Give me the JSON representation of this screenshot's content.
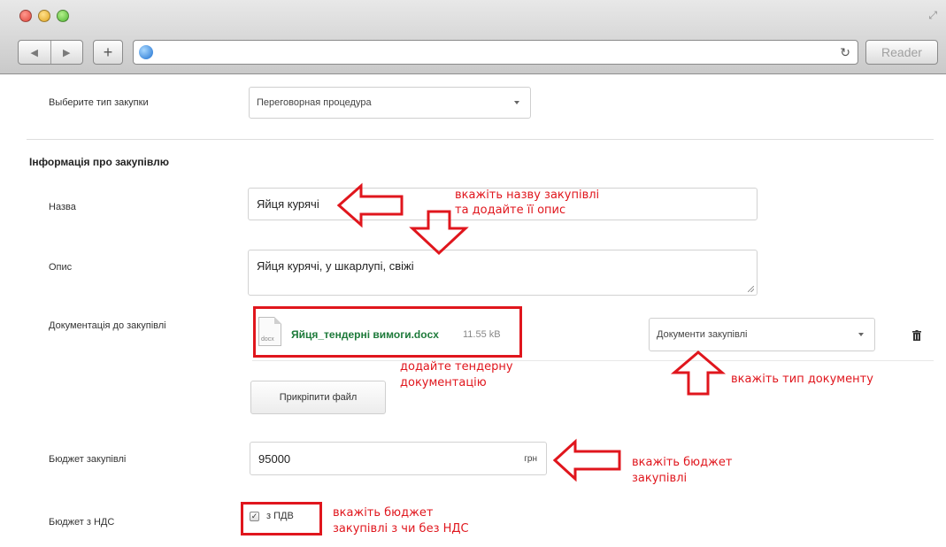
{
  "browser": {
    "reader_label": "Reader",
    "colors": {
      "close": "#e0443a",
      "minimize": "#e0a420",
      "zoom": "#4fb532"
    }
  },
  "form": {
    "purchase_type": {
      "label": "Выберите тип закупки",
      "value": "Переговорная процедура"
    },
    "section_title": "Інформація про закупівлю",
    "name": {
      "label": "Назва",
      "value": "Яйця курячі"
    },
    "description": {
      "label": "Опис",
      "value": "Яйця курячі, у шкарлупі, свіжі"
    },
    "documentation": {
      "label": "Документація до закупівлі",
      "file_name": "Яйця_тендерні вимоги.docx",
      "file_size": "11.55 kB",
      "file_ext": "docx",
      "doc_type": "Документи закупівлі",
      "attach_label": "Прикріпити файл"
    },
    "budget": {
      "label": "Бюджет закупівлі",
      "value": "95000",
      "currency": "грн"
    },
    "vat": {
      "label": "Бюджет з НДС",
      "checkbox_label": "з ПДВ",
      "checked": true
    }
  },
  "annotations": {
    "name_line1": "вкажіть назву закупівлі",
    "name_line2": "та додайте її опис",
    "docs_line1": "додайте тендерну",
    "docs_line2": "документацію",
    "doc_type": "вкажіть тип документу",
    "budget_line1": "вкажіть бюджет",
    "budget_line2": "закупівлі",
    "vat_line1": "вкажіть бюджет",
    "vat_line2": "закупівлі з чи без НДС",
    "color": "#e0161d"
  }
}
